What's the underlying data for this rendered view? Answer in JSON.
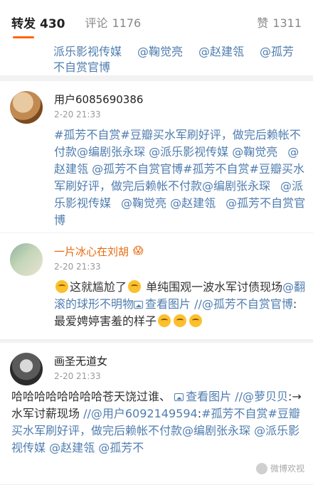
{
  "tabs": {
    "repost": {
      "label": "转发",
      "count": "430"
    },
    "comment": {
      "label": "评论",
      "count": "1176"
    },
    "like": {
      "label": "赞",
      "count": "1311"
    }
  },
  "top_fragment": {
    "line1": [
      "派乐影视传媒",
      "@鞠觉亮",
      "@赵建瓴",
      "@孤芳"
    ],
    "line2": "不自赏官博"
  },
  "comments": [
    {
      "user": "用户6085690386",
      "time": "2-20 21:33",
      "t1": "#孤芳不自赏#豆瓣买水军刷好评，做完后赖帐不付款",
      "t2": "@编剧张永琛",
      "t3": "@派乐影视传媒",
      "t4": "@鞠觉亮",
      "t5": "@赵建瓴",
      "t6": "@孤芳不自赏官博",
      "t7": "#孤芳不自赏#豆瓣买水军刷好评，做完后赖帐不付款",
      "t8": "@编剧张永琛",
      "t9": "@派乐影视传媒",
      "t10": "@鞠觉亮",
      "t11": "@赵建瓴",
      "t12": "@孤芳不自赏官博"
    },
    {
      "user": "一片冰心在刘胡",
      "time": "2-20 21:33",
      "t1": "这就尴尬了",
      "t2": "单纯围观一波水军讨债现场",
      "t3": "@翻滚的球形不明物",
      "t4": "查看图片",
      "t5": "//@孤芳不自赏官博",
      "t6": ":最爱娉婷害羞的样子"
    },
    {
      "user": "画圣无道女",
      "time": "2-20 21:33",
      "t1": "哈哈哈哈哈哈哈哈苍天饶过谁、",
      "t2": "查看图片",
      "t3": "//@萝贝贝",
      "t4": ":→水军讨薪现场 ",
      "t5": "//@用户6092149594",
      "t6": ":",
      "t7": "#孤芳不自赏#豆瓣买水军刷好评，做完后赖帐不付款",
      "t8": "@编剧张永琛",
      "t9": "@派乐影视传媒",
      "t10": "@赵建瓴",
      "t11": "@孤芳不"
    }
  ],
  "watermark": "微博欢视"
}
